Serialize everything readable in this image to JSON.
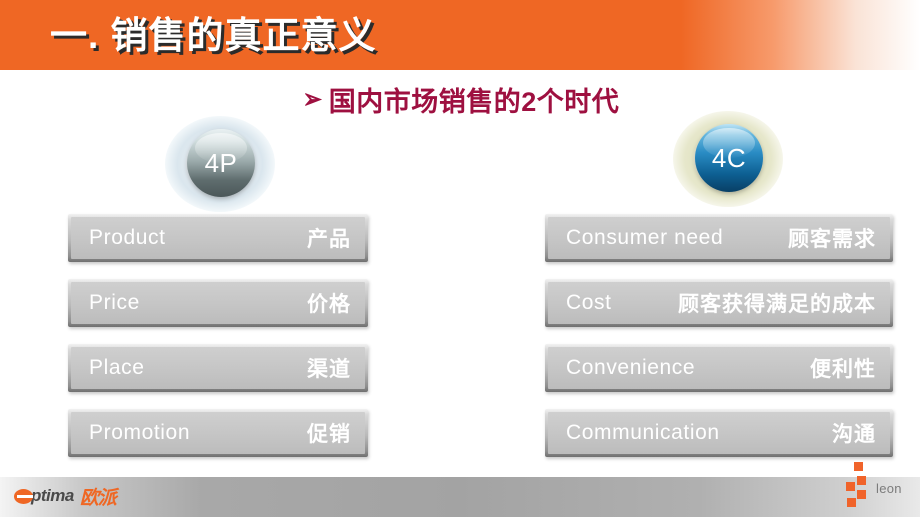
{
  "header": {
    "title": "一. 销售的真正意义",
    "bar_color": "#ef6724",
    "title_color": "#ffffff",
    "shadow_color": "#2b2b2b"
  },
  "subtitle": {
    "bullet": "➢",
    "text": "国内市场销售的2个时代",
    "color": "#9e1040"
  },
  "columns": [
    {
      "badge": {
        "label": "4P",
        "ball_color": "#8f9fa0",
        "glow_color": "#cde0ea"
      },
      "items": [
        {
          "en": "Product",
          "cn": "产品"
        },
        {
          "en": "Price",
          "cn": "价格"
        },
        {
          "en": "Place",
          "cn": "渠道"
        },
        {
          "en": "Promotion",
          "cn": "促销"
        }
      ]
    },
    {
      "badge": {
        "label": "4C",
        "ball_color": "#1b7fb6",
        "glow_color": "#e2e3c2"
      },
      "items": [
        {
          "en": "Consumer need",
          "cn": "顾客需求"
        },
        {
          "en": "Cost",
          "cn": "顾客获得满足的成本"
        },
        {
          "en": "Convenience",
          "cn": "便利性"
        },
        {
          "en": "Communication",
          "cn": "沟通"
        }
      ]
    }
  ],
  "footer": {
    "brand_word": "ptima",
    "brand_cn": "欧派",
    "brand_color": "#ef6724",
    "watermark": "leon",
    "watermark_color": "#7c7c7c",
    "square_color": "#f0632a"
  }
}
